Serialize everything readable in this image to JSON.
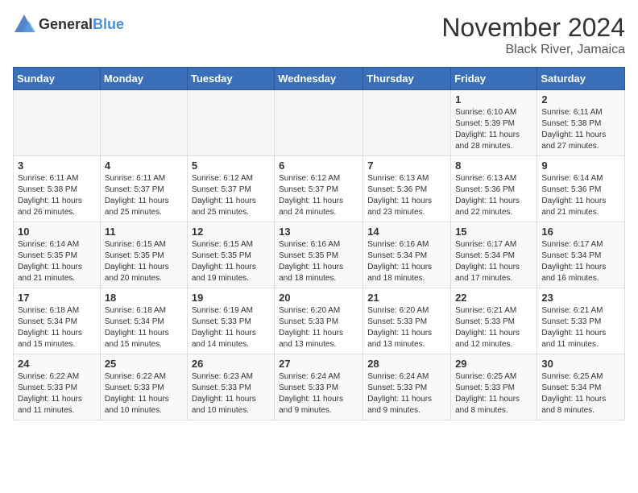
{
  "logo": {
    "text1": "General",
    "text2": "Blue"
  },
  "title": "November 2024",
  "subtitle": "Black River, Jamaica",
  "days_of_week": [
    "Sunday",
    "Monday",
    "Tuesday",
    "Wednesday",
    "Thursday",
    "Friday",
    "Saturday"
  ],
  "weeks": [
    [
      {
        "day": "",
        "info": ""
      },
      {
        "day": "",
        "info": ""
      },
      {
        "day": "",
        "info": ""
      },
      {
        "day": "",
        "info": ""
      },
      {
        "day": "",
        "info": ""
      },
      {
        "day": "1",
        "info": "Sunrise: 6:10 AM\nSunset: 5:39 PM\nDaylight: 11 hours and 28 minutes."
      },
      {
        "day": "2",
        "info": "Sunrise: 6:11 AM\nSunset: 5:38 PM\nDaylight: 11 hours and 27 minutes."
      }
    ],
    [
      {
        "day": "3",
        "info": "Sunrise: 6:11 AM\nSunset: 5:38 PM\nDaylight: 11 hours and 26 minutes."
      },
      {
        "day": "4",
        "info": "Sunrise: 6:11 AM\nSunset: 5:37 PM\nDaylight: 11 hours and 25 minutes."
      },
      {
        "day": "5",
        "info": "Sunrise: 6:12 AM\nSunset: 5:37 PM\nDaylight: 11 hours and 25 minutes."
      },
      {
        "day": "6",
        "info": "Sunrise: 6:12 AM\nSunset: 5:37 PM\nDaylight: 11 hours and 24 minutes."
      },
      {
        "day": "7",
        "info": "Sunrise: 6:13 AM\nSunset: 5:36 PM\nDaylight: 11 hours and 23 minutes."
      },
      {
        "day": "8",
        "info": "Sunrise: 6:13 AM\nSunset: 5:36 PM\nDaylight: 11 hours and 22 minutes."
      },
      {
        "day": "9",
        "info": "Sunrise: 6:14 AM\nSunset: 5:36 PM\nDaylight: 11 hours and 21 minutes."
      }
    ],
    [
      {
        "day": "10",
        "info": "Sunrise: 6:14 AM\nSunset: 5:35 PM\nDaylight: 11 hours and 21 minutes."
      },
      {
        "day": "11",
        "info": "Sunrise: 6:15 AM\nSunset: 5:35 PM\nDaylight: 11 hours and 20 minutes."
      },
      {
        "day": "12",
        "info": "Sunrise: 6:15 AM\nSunset: 5:35 PM\nDaylight: 11 hours and 19 minutes."
      },
      {
        "day": "13",
        "info": "Sunrise: 6:16 AM\nSunset: 5:35 PM\nDaylight: 11 hours and 18 minutes."
      },
      {
        "day": "14",
        "info": "Sunrise: 6:16 AM\nSunset: 5:34 PM\nDaylight: 11 hours and 18 minutes."
      },
      {
        "day": "15",
        "info": "Sunrise: 6:17 AM\nSunset: 5:34 PM\nDaylight: 11 hours and 17 minutes."
      },
      {
        "day": "16",
        "info": "Sunrise: 6:17 AM\nSunset: 5:34 PM\nDaylight: 11 hours and 16 minutes."
      }
    ],
    [
      {
        "day": "17",
        "info": "Sunrise: 6:18 AM\nSunset: 5:34 PM\nDaylight: 11 hours and 15 minutes."
      },
      {
        "day": "18",
        "info": "Sunrise: 6:18 AM\nSunset: 5:34 PM\nDaylight: 11 hours and 15 minutes."
      },
      {
        "day": "19",
        "info": "Sunrise: 6:19 AM\nSunset: 5:33 PM\nDaylight: 11 hours and 14 minutes."
      },
      {
        "day": "20",
        "info": "Sunrise: 6:20 AM\nSunset: 5:33 PM\nDaylight: 11 hours and 13 minutes."
      },
      {
        "day": "21",
        "info": "Sunrise: 6:20 AM\nSunset: 5:33 PM\nDaylight: 11 hours and 13 minutes."
      },
      {
        "day": "22",
        "info": "Sunrise: 6:21 AM\nSunset: 5:33 PM\nDaylight: 11 hours and 12 minutes."
      },
      {
        "day": "23",
        "info": "Sunrise: 6:21 AM\nSunset: 5:33 PM\nDaylight: 11 hours and 11 minutes."
      }
    ],
    [
      {
        "day": "24",
        "info": "Sunrise: 6:22 AM\nSunset: 5:33 PM\nDaylight: 11 hours and 11 minutes."
      },
      {
        "day": "25",
        "info": "Sunrise: 6:22 AM\nSunset: 5:33 PM\nDaylight: 11 hours and 10 minutes."
      },
      {
        "day": "26",
        "info": "Sunrise: 6:23 AM\nSunset: 5:33 PM\nDaylight: 11 hours and 10 minutes."
      },
      {
        "day": "27",
        "info": "Sunrise: 6:24 AM\nSunset: 5:33 PM\nDaylight: 11 hours and 9 minutes."
      },
      {
        "day": "28",
        "info": "Sunrise: 6:24 AM\nSunset: 5:33 PM\nDaylight: 11 hours and 9 minutes."
      },
      {
        "day": "29",
        "info": "Sunrise: 6:25 AM\nSunset: 5:33 PM\nDaylight: 11 hours and 8 minutes."
      },
      {
        "day": "30",
        "info": "Sunrise: 6:25 AM\nSunset: 5:34 PM\nDaylight: 11 hours and 8 minutes."
      }
    ]
  ]
}
